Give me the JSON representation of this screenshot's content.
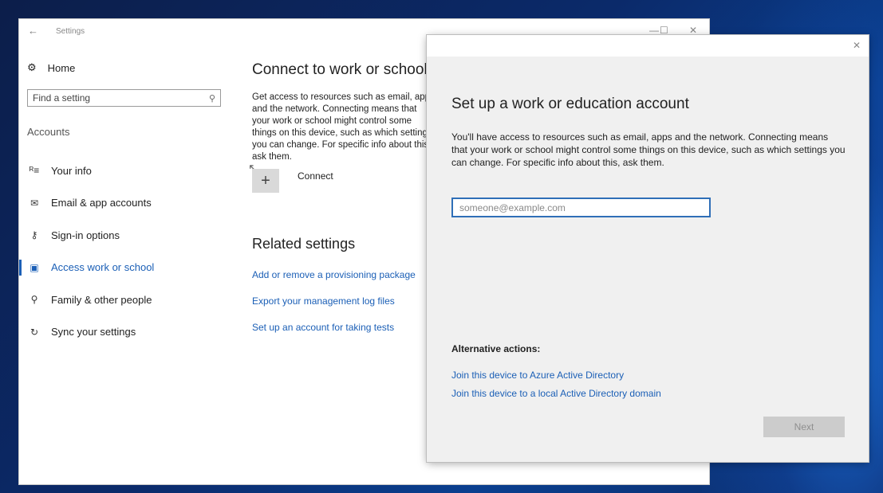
{
  "settings_window": {
    "back_glyph": "←",
    "title": "Settings",
    "minimize_glyph": "—",
    "maximize_glyph": "☐",
    "close_glyph": "✕"
  },
  "sidebar": {
    "home_label": "Home",
    "home_icon": "gear-icon",
    "search_placeholder": "Find a setting",
    "section_label": "Accounts",
    "items": [
      {
        "label": "Your info",
        "icon": "person-card-icon",
        "glyph": "ᴿ≡"
      },
      {
        "label": "Email & app accounts",
        "icon": "mail-icon",
        "glyph": "✉"
      },
      {
        "label": "Sign-in options",
        "icon": "key-icon",
        "glyph": "⚷"
      },
      {
        "label": "Access work or school",
        "icon": "briefcase-icon",
        "glyph": "▣",
        "active": true
      },
      {
        "label": "Family & other people",
        "icon": "people-icon",
        "glyph": "⚲"
      },
      {
        "label": "Sync your settings",
        "icon": "sync-icon",
        "glyph": "↻"
      }
    ]
  },
  "main": {
    "title": "Connect to work or school",
    "description": "Get access to resources such as email, apps and the network. Connecting means that your work or school might control some things on this device, such as which settings you can change. For specific info about this, ask them.",
    "connect_label": "Connect",
    "connect_glyph": "+",
    "related_title": "Related settings",
    "related_links": [
      "Add or remove a provisioning package",
      "Export your management log files",
      "Set up an account for taking tests"
    ]
  },
  "dialog": {
    "close_glyph": "✕",
    "title": "Set up a work or education account",
    "description": "You'll have access to resources such as email, apps and the network. Connecting means that your work or school might control some things on this device, such as which settings you can change. For specific info about this, ask them.",
    "email_placeholder": "someone@example.com",
    "email_value": "",
    "alternative_title": "Alternative actions:",
    "alternative_links": [
      "Join this device to Azure Active Directory",
      "Join this device to a local Active Directory domain"
    ],
    "next_label": "Next"
  },
  "colors": {
    "accent": "#1b5fb6",
    "desktop": "#0b2a6a",
    "dialog_bg": "#f0f0f0"
  }
}
